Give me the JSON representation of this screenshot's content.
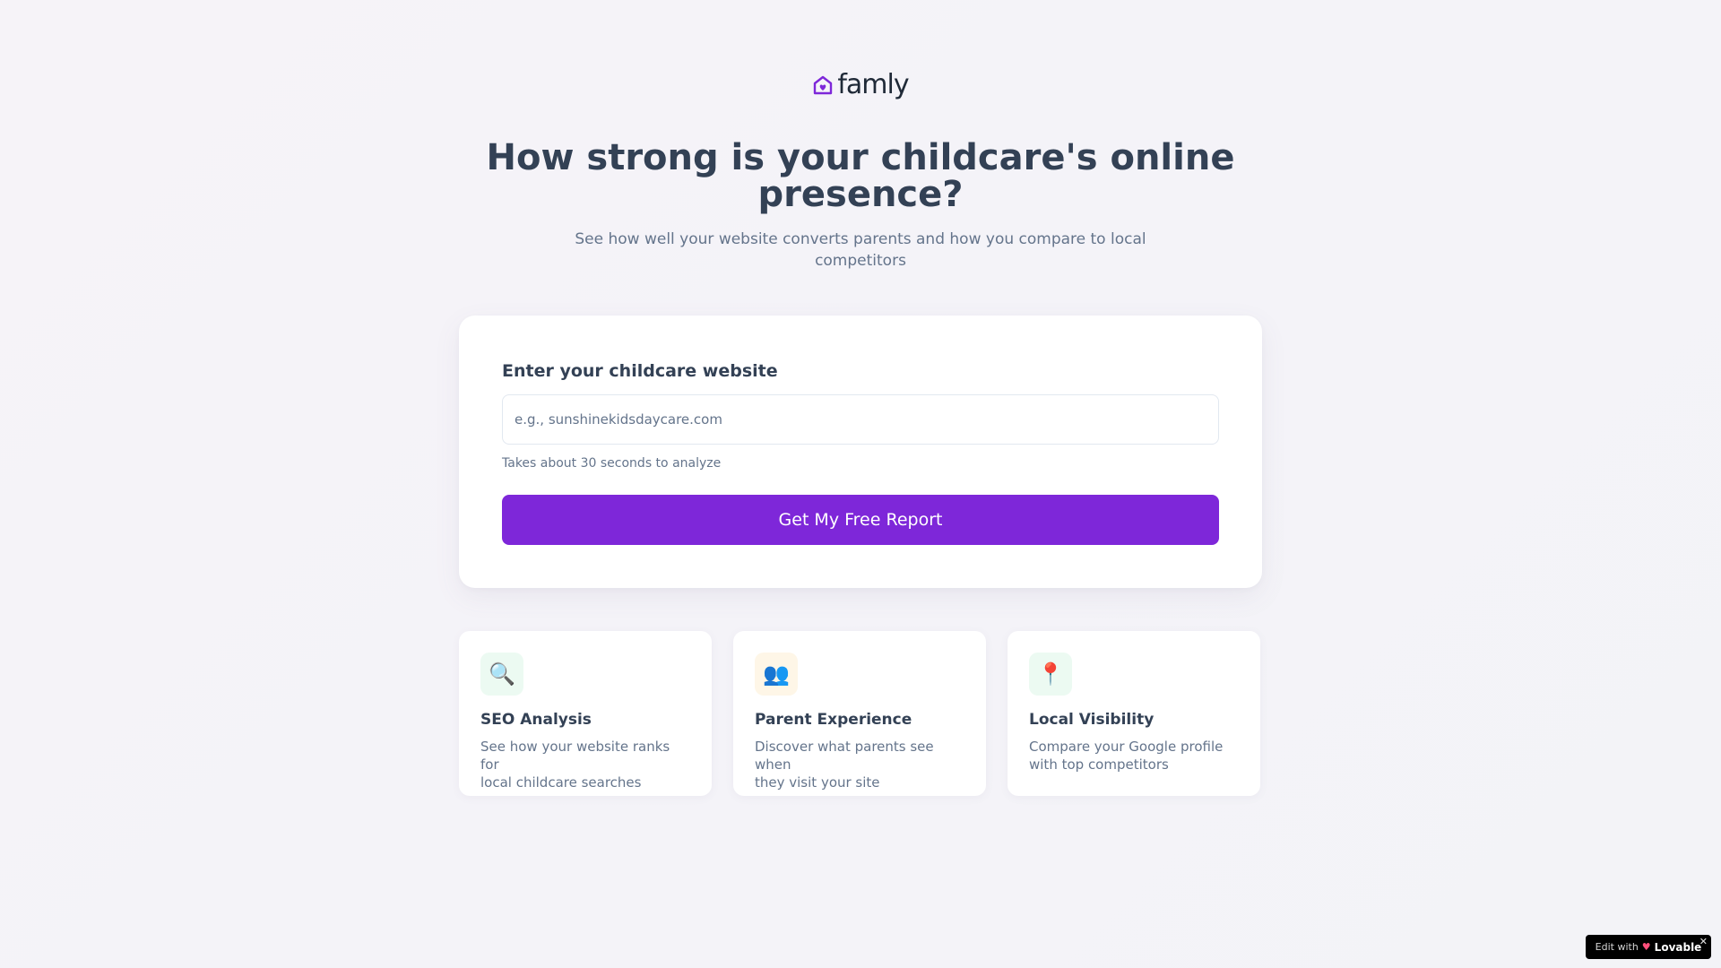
{
  "brand": {
    "name": "famly",
    "logo_icon": "house-heart-icon",
    "accent_color": "#7e27d9"
  },
  "hero": {
    "title_line1": "How strong is your childcare's online",
    "title_line2": "presence?",
    "subtitle_line1": "See how well your website converts parents and how you compare to local",
    "subtitle_line2": "competitors"
  },
  "form": {
    "label": "Enter your childcare website",
    "input_value": "",
    "input_placeholder": "e.g., sunshinekidsdaycare.com",
    "hint": "Takes about 30 seconds to analyze",
    "submit_label": "Get My Free Report"
  },
  "features": [
    {
      "icon": "magnifier-icon",
      "icon_glyph": "🔍",
      "icon_bg": "#ecfaf2",
      "title": "SEO Analysis",
      "desc_line1": "See how your website ranks for",
      "desc_line2": "local childcare searches"
    },
    {
      "icon": "people-icon",
      "icon_glyph": "👥",
      "icon_bg": "#fef6e7",
      "title": "Parent Experience",
      "desc_line1": "Discover what parents see when",
      "desc_line2": "they visit your site"
    },
    {
      "icon": "location-pin-icon",
      "icon_glyph": "📍",
      "icon_bg": "#ecfaf2",
      "title": "Local Visibility",
      "desc_line1": "Compare your Google profile",
      "desc_line2": "with top competitors"
    }
  ],
  "badge": {
    "prefix": "Edit with",
    "brand": "Lovable",
    "close": "✕"
  }
}
